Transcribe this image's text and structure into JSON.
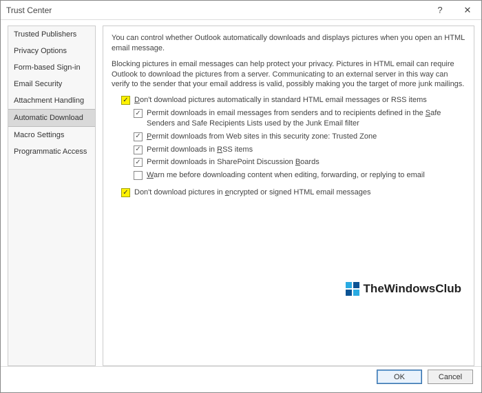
{
  "titlebar": {
    "title": "Trust Center",
    "help": "?",
    "close": "✕"
  },
  "sidebar": {
    "items": [
      {
        "label": "Trusted Publishers"
      },
      {
        "label": "Privacy Options"
      },
      {
        "label": "Form-based Sign-in"
      },
      {
        "label": "Email Security"
      },
      {
        "label": "Attachment Handling"
      },
      {
        "label": "Automatic Download",
        "selected": true
      },
      {
        "label": "Macro Settings"
      },
      {
        "label": "Programmatic Access"
      }
    ]
  },
  "content": {
    "intro1": "You can control whether Outlook automatically downloads and displays pictures when you open an HTML email message.",
    "intro2": "Blocking pictures in email messages can help protect your privacy. Pictures in HTML email can require Outlook to download the pictures from a server. Communicating to an external server in this way can verify to the sender that your email address is valid, possibly making you the target of more junk mailings.",
    "opt_main": {
      "pre": "",
      "ul": "D",
      "post": "on't download pictures automatically in standard HTML email messages or RSS items",
      "checked": true,
      "highlight": true
    },
    "sub": [
      {
        "pre": "Permit downloads in email messages from senders and to recipients defined in the ",
        "ul": "S",
        "post": "afe Senders and Safe Recipients Lists used by the Junk Email filter",
        "checked": true
      },
      {
        "pre": "",
        "ul": "P",
        "post": "ermit downloads from Web sites in this security zone: Trusted Zone",
        "checked": true
      },
      {
        "pre": "Permit downloads in ",
        "ul": "R",
        "post": "SS items",
        "checked": true
      },
      {
        "pre": "Permit downloads in SharePoint Discussion ",
        "ul": "B",
        "post": "oards",
        "checked": true
      },
      {
        "pre": "",
        "ul": "W",
        "post": "arn me before downloading content when editing, forwarding, or replying to email",
        "checked": false
      }
    ],
    "opt_enc": {
      "pre": "Don't download pictures in ",
      "ul": "e",
      "post": "ncrypted or signed HTML email messages",
      "checked": true,
      "highlight": true
    },
    "watermark": "TheWindowsClub"
  },
  "footer": {
    "ok": "OK",
    "cancel": "Cancel"
  }
}
